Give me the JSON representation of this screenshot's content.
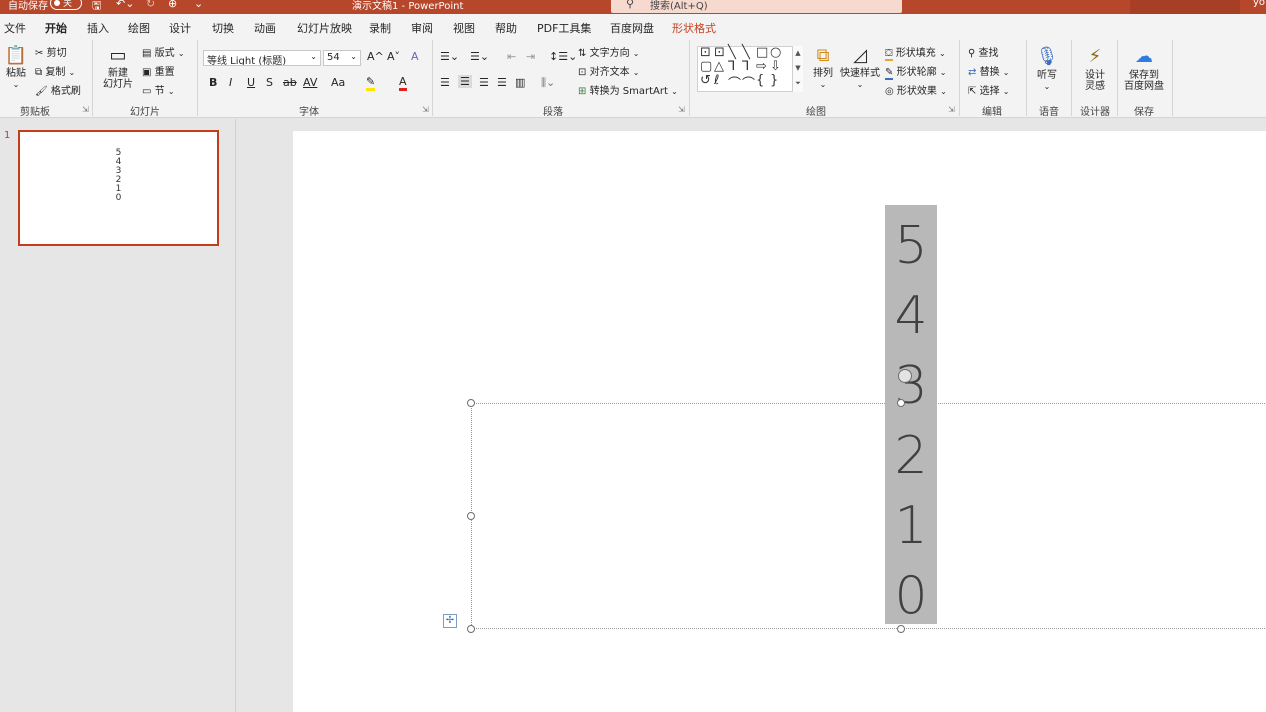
{
  "titlebar": {
    "autosave_label": "自动保存",
    "autosave_state": "关",
    "document_title": "演示文稿1  -  PowerPoint",
    "search_placeholder": "搜索(Alt+Q)",
    "user_initial": "yo",
    "accent_color": "#b7472a"
  },
  "tabs": [
    {
      "label": "文件"
    },
    {
      "label": "开始",
      "active": true
    },
    {
      "label": "插入"
    },
    {
      "label": "绘图"
    },
    {
      "label": "设计"
    },
    {
      "label": "切换"
    },
    {
      "label": "动画"
    },
    {
      "label": "幻灯片放映"
    },
    {
      "label": "录制"
    },
    {
      "label": "审阅"
    },
    {
      "label": "视图"
    },
    {
      "label": "帮助"
    },
    {
      "label": "PDF工具集"
    },
    {
      "label": "百度网盘"
    },
    {
      "label": "形状格式",
      "contextual": true
    }
  ],
  "ribbon": {
    "clipboard": {
      "paste": "粘贴",
      "cut": "剪切",
      "copy": "复制",
      "format_painter": "格式刷",
      "group": "剪贴板"
    },
    "slides": {
      "new_slide_line1": "新建",
      "new_slide_line2": "幻灯片",
      "layout": "版式",
      "reset": "重置",
      "section": "节",
      "group": "幻灯片"
    },
    "font": {
      "font_name": "等线 Light (标题)",
      "font_size": "54",
      "bold": "B",
      "italic": "I",
      "underline": "U",
      "shadow": "S",
      "strike": "ab",
      "spacing": "AV",
      "case": "Aa",
      "grow": "A^",
      "shrink": "A˅",
      "clear": "A",
      "font_color": "A",
      "group": "字体"
    },
    "paragraph": {
      "text_direction": "文字方向",
      "align_text": "对齐文本",
      "smartart": "转换为 SmartArt",
      "group": "段落"
    },
    "drawing": {
      "arrange": "排列",
      "quick_styles": "快速样式",
      "shape_fill": "形状填充",
      "shape_outline": "形状轮廓",
      "shape_effects": "形状效果",
      "group": "绘图"
    },
    "editing": {
      "find": "查找",
      "replace": "替换",
      "select": "选择",
      "group": "编辑"
    },
    "voice": {
      "dictate": "听写",
      "group": "语音"
    },
    "designer": {
      "line1": "设计",
      "line2": "灵感",
      "group": "设计器"
    },
    "save": {
      "line1": "保存到",
      "line2": "百度网盘",
      "group": "保存"
    }
  },
  "thumbnails": [
    {
      "number": "1",
      "digits": [
        "5",
        "4",
        "3",
        "2",
        "1",
        "0"
      ]
    }
  ],
  "slide": {
    "digits": [
      "5",
      "4",
      "3",
      "2",
      "1",
      "0"
    ]
  }
}
